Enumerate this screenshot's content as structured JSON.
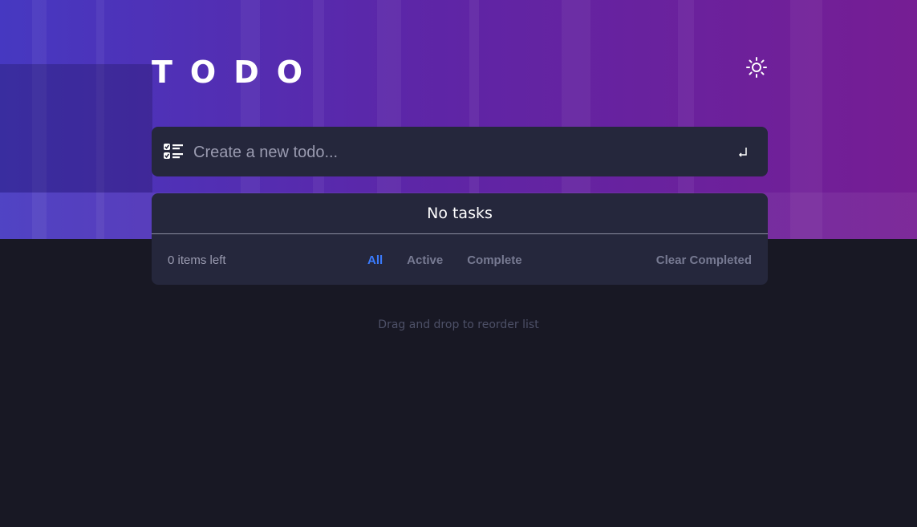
{
  "header": {
    "title": "TODO",
    "theme_toggle_icon": "sun-icon"
  },
  "new_todo": {
    "placeholder": "Create a new todo...",
    "value": "",
    "list_icon": "checklist-icon",
    "submit_icon": "enter-icon"
  },
  "list": {
    "empty_message": "No tasks"
  },
  "footer": {
    "items_left": "0 items left",
    "filters": [
      {
        "label": "All",
        "active": true
      },
      {
        "label": "Active",
        "active": false
      },
      {
        "label": "Complete",
        "active": false
      }
    ],
    "clear_label": "Clear Completed"
  },
  "hint": "Drag and drop to reorder list",
  "colors": {
    "background": "#181824",
    "card": "#25273c",
    "accent": "#3a7bfd",
    "muted": "#777a92"
  }
}
